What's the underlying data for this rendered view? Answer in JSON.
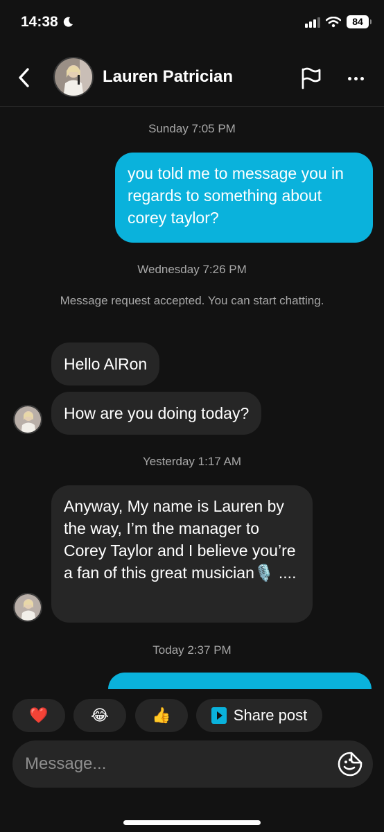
{
  "status_bar": {
    "time": "14:38",
    "battery": "84"
  },
  "header": {
    "contact_name": "Lauren Patrician"
  },
  "messages": {
    "ts1": "Sunday 7:05 PM",
    "out1": "you told me to message you in regards to something about corey taylor?",
    "ts2": "Wednesday 7:26 PM",
    "system": "Message request accepted. You can start chatting.",
    "in1": "Hello AlRon",
    "in2": "How are you doing today?",
    "ts3": "Yesterday 1:17 AM",
    "in3": "Anyway, My name is Lauren by the way, I’m the manager to Corey Taylor  and I believe you’re a fan of this great musician🎙️ ....",
    "ts4": "Today 2:37 PM"
  },
  "quick_replies": {
    "heart": "❤️",
    "laugh": "😂",
    "thumbs": "👍",
    "share_label": "Share post"
  },
  "composer": {
    "placeholder": "Message..."
  },
  "colors": {
    "outgoing_bubble": "#0ab2dc",
    "incoming_bubble": "#262626",
    "background": "#121212"
  }
}
